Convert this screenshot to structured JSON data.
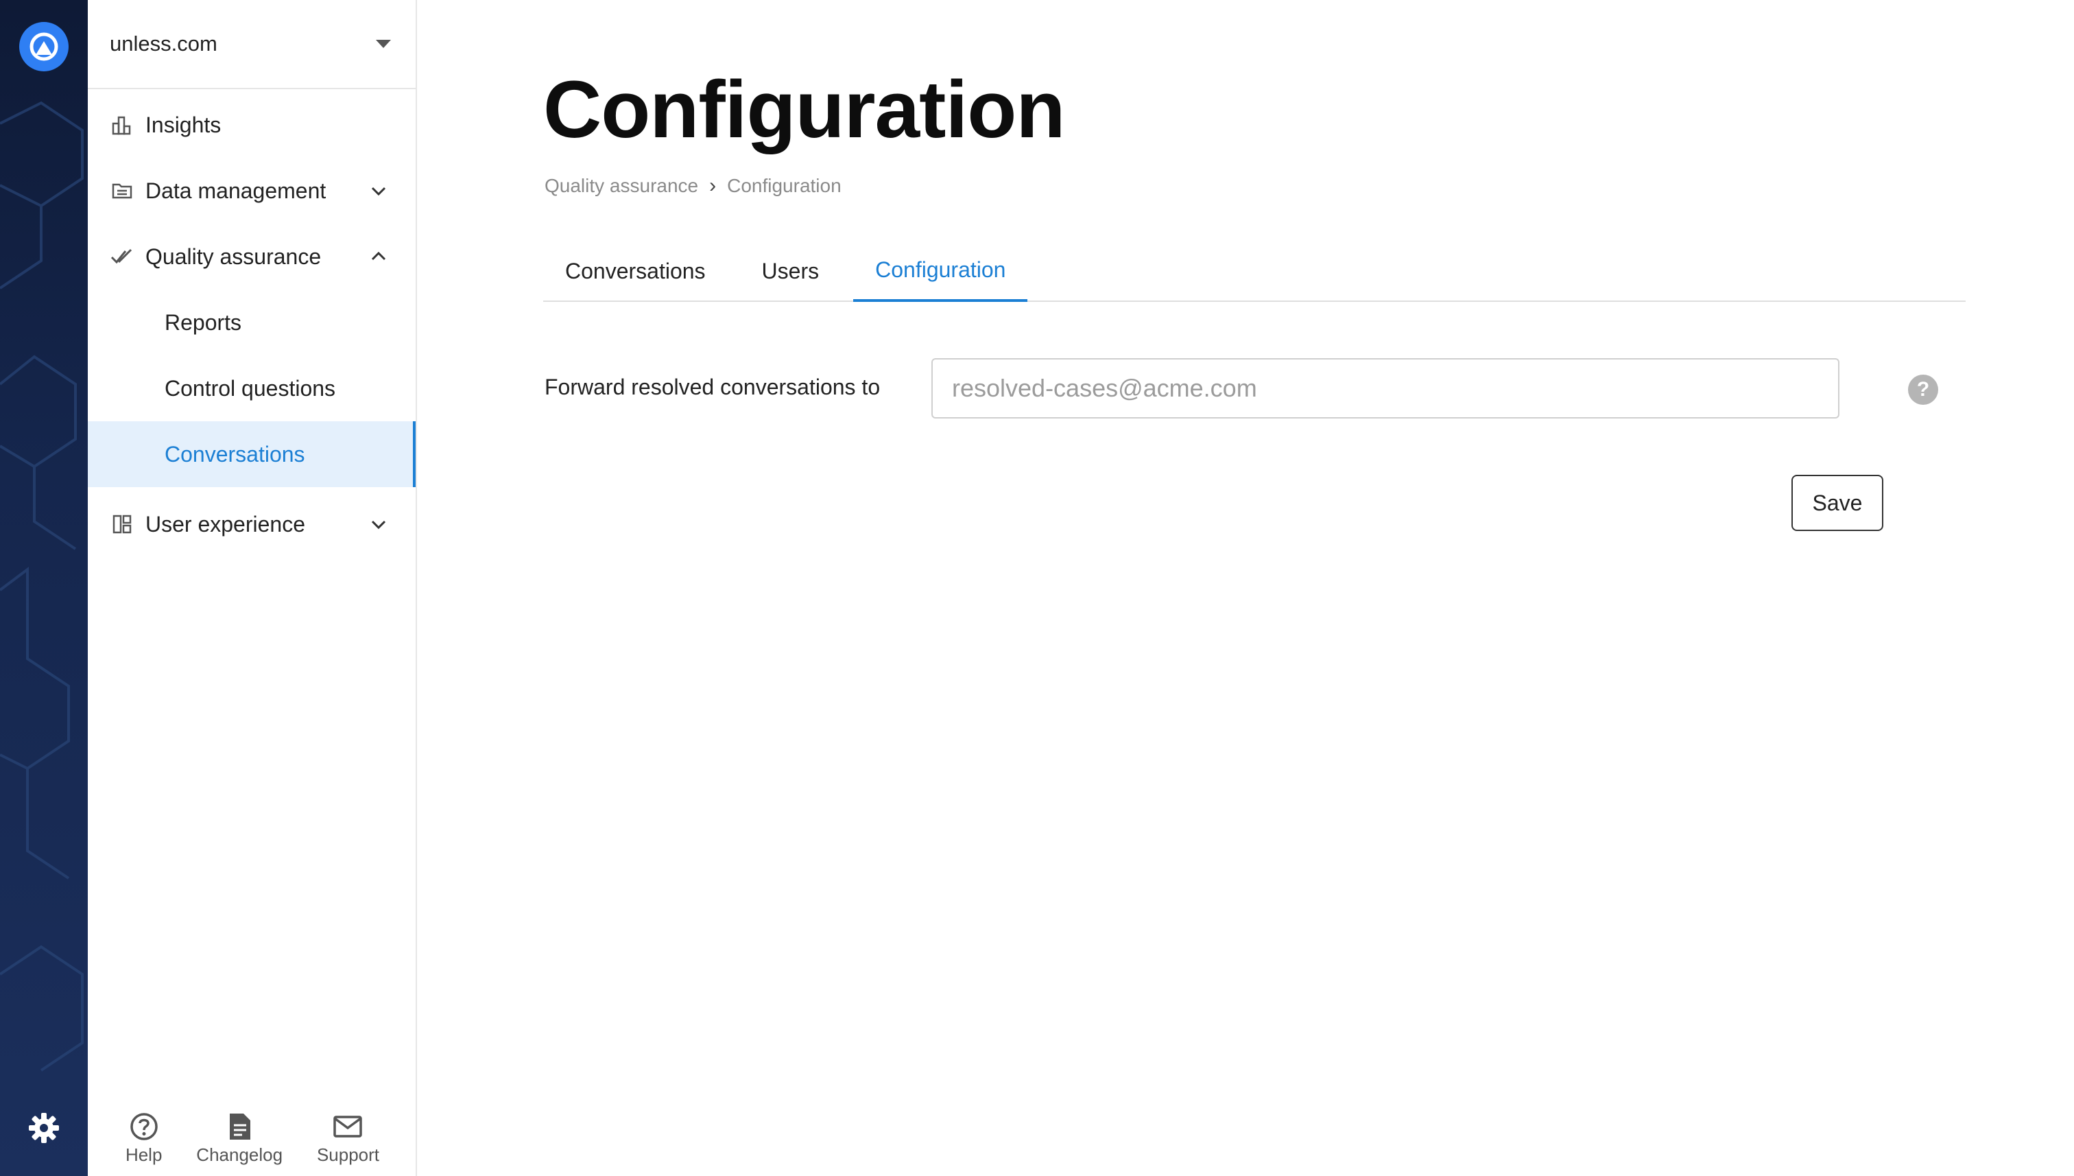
{
  "workspace": {
    "name": "unless.com"
  },
  "sidebar": {
    "items": [
      {
        "label": "Insights",
        "icon": "bar-chart-icon"
      },
      {
        "label": "Data management",
        "icon": "folder-icon",
        "expanded": false
      },
      {
        "label": "Quality assurance",
        "icon": "check-icon",
        "expanded": true,
        "children": [
          {
            "label": "Reports",
            "active": false
          },
          {
            "label": "Control questions",
            "active": false
          },
          {
            "label": "Conversations",
            "active": true
          }
        ]
      },
      {
        "label": "User experience",
        "icon": "layout-icon",
        "expanded": false
      }
    ],
    "bottom_links": [
      {
        "label": "Help",
        "icon": "help-circle-icon"
      },
      {
        "label": "Changelog",
        "icon": "document-icon"
      },
      {
        "label": "Support",
        "icon": "mail-icon"
      }
    ]
  },
  "page": {
    "title": "Configuration",
    "breadcrumb": [
      "Quality assurance",
      "Configuration"
    ],
    "tabs": [
      {
        "label": "Conversations",
        "active": false
      },
      {
        "label": "Users",
        "active": false
      },
      {
        "label": "Configuration",
        "active": true
      }
    ],
    "form": {
      "forward_label": "Forward resolved conversations to",
      "forward_placeholder": "resolved-cases@acme.com",
      "forward_value": "",
      "help_glyph": "?"
    },
    "save_label": "Save"
  },
  "colors": {
    "accent": "#1b7fd4",
    "active_bg": "#e4f0fc",
    "rail_bg": "#15264d",
    "logo": "#2f7ff3"
  }
}
